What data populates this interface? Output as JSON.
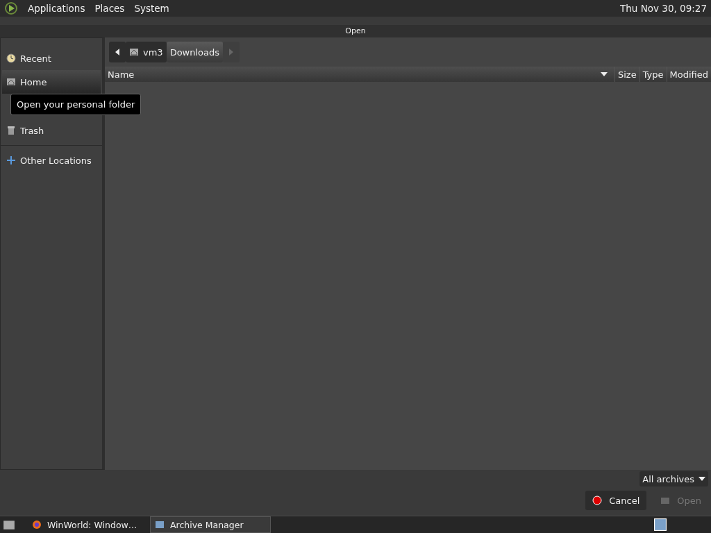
{
  "top_panel": {
    "menus": [
      "Applications",
      "Places",
      "System"
    ],
    "clock": "Thu Nov 30, 09:27"
  },
  "window": {
    "title": "Open"
  },
  "sidebar": {
    "items": [
      {
        "label": "Recent",
        "kind": "clock",
        "selected": false
      },
      {
        "label": "Home",
        "kind": "home",
        "selected": true
      },
      {
        "label": "Trash",
        "kind": "trash",
        "selected": false
      },
      {
        "label": "Other Locations",
        "kind": "plus",
        "selected": false,
        "separator_before": true
      }
    ]
  },
  "tooltip": "Open your personal folder",
  "path_bar": {
    "segments": [
      {
        "label": "vm3",
        "kind": "home",
        "selected": false
      },
      {
        "label": "Downloads",
        "selected": true
      }
    ]
  },
  "table": {
    "columns": [
      "Name",
      "Size",
      "Type",
      "Modified"
    ]
  },
  "filter": "All archives",
  "buttons": [
    {
      "label": "Cancel",
      "kind": "cancel",
      "disabled": false
    },
    {
      "label": "Open",
      "kind": "open",
      "disabled": true
    }
  ],
  "taskbar": {
    "tasks": [
      {
        "label": "WinWorld: Window…",
        "kind": "browser",
        "selected": false
      },
      {
        "label": "Archive Manager",
        "kind": "archive",
        "selected": true
      }
    ]
  }
}
